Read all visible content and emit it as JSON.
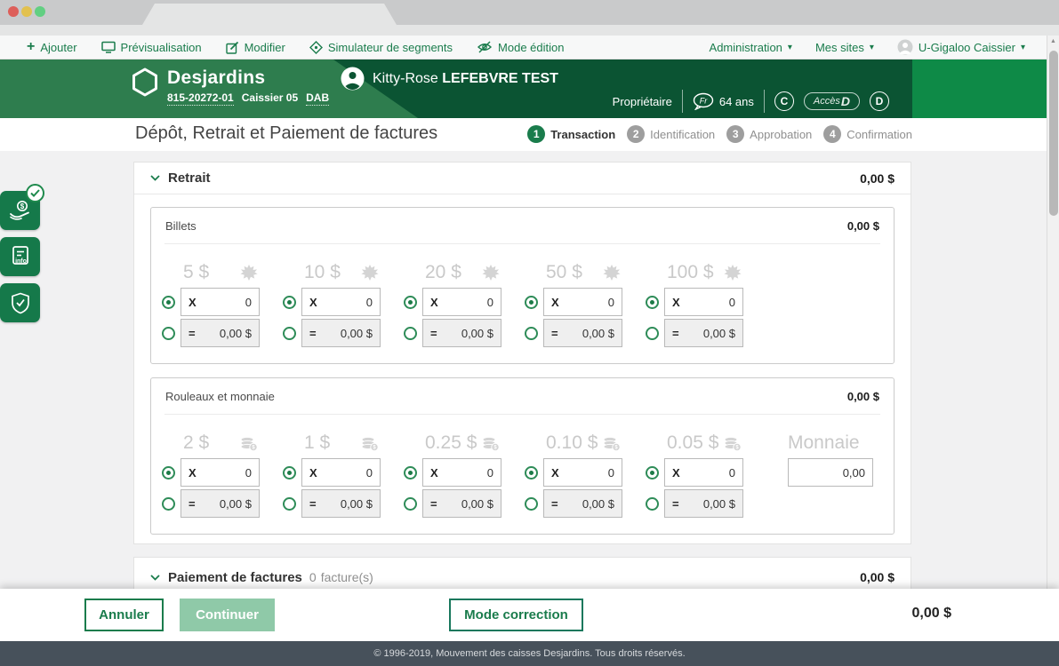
{
  "icons": {
    "caret_down": "▾",
    "scroll_up": "▲",
    "plus": "+"
  },
  "toolbar": {
    "ajouter": "Ajouter",
    "previsualisation": "Prévisualisation",
    "modifier": "Modifier",
    "simulateur": "Simulateur de segments",
    "mode_edition": "Mode édition",
    "administration": "Administration",
    "mes_sites": "Mes sites",
    "user": "U-Gigaloo Caissier"
  },
  "header": {
    "brand": "Desjardins",
    "transit": "815-20272-01",
    "caissier": "Caissier 05",
    "dab": "DAB",
    "client_first": "Kitty-Rose",
    "client_last": "LEFEBVRE TEST",
    "role": "Propriétaire",
    "lang": "Fr",
    "age": "64 ans",
    "badge_c": "C",
    "badge_accesd_a": "Accès",
    "badge_accesd_d": "D",
    "badge_d": "D"
  },
  "page": {
    "title": "Dépôt, Retrait et Paiement de factures",
    "steps": [
      {
        "num": "1",
        "label": "Transaction"
      },
      {
        "num": "2",
        "label": "Identification"
      },
      {
        "num": "3",
        "label": "Approbation"
      },
      {
        "num": "4",
        "label": "Confirmation"
      }
    ]
  },
  "retrait": {
    "title": "Retrait",
    "total": "0,00 $",
    "billets": {
      "title": "Billets",
      "total": "0,00 $",
      "denominations": [
        "5 $",
        "10 $",
        "20 $",
        "50 $",
        "100 $"
      ]
    },
    "rouleaux": {
      "title": "Rouleaux et monnaie",
      "total": "0,00 $",
      "denominations": [
        "2 $",
        "1 $",
        "0.25 $",
        "0.10 $",
        "0.05 $"
      ],
      "monnaie_label": "Monnaie",
      "monnaie_value": "0,00"
    }
  },
  "cells": {
    "qty_prefix": "X",
    "qty_value": "0",
    "amt_prefix": "=",
    "amt_value": "0,00 $"
  },
  "paiement": {
    "title": "Paiement de factures",
    "count": "0",
    "count_suffix": "facture(s)",
    "total": "0,00 $"
  },
  "actions": {
    "annuler": "Annuler",
    "continuer": "Continuer",
    "mode_correction": "Mode correction",
    "total": "0,00 $"
  },
  "footer": "© 1996-2019, Mouvement des caisses Desjardins. Tous droits réservés.",
  "colors": {
    "brand_green": "#1a7c4c",
    "header_green": "#2e7d4e",
    "header_dark": "#0b5433",
    "header_bright": "#0e8a47",
    "footer_bg": "#47515b"
  }
}
